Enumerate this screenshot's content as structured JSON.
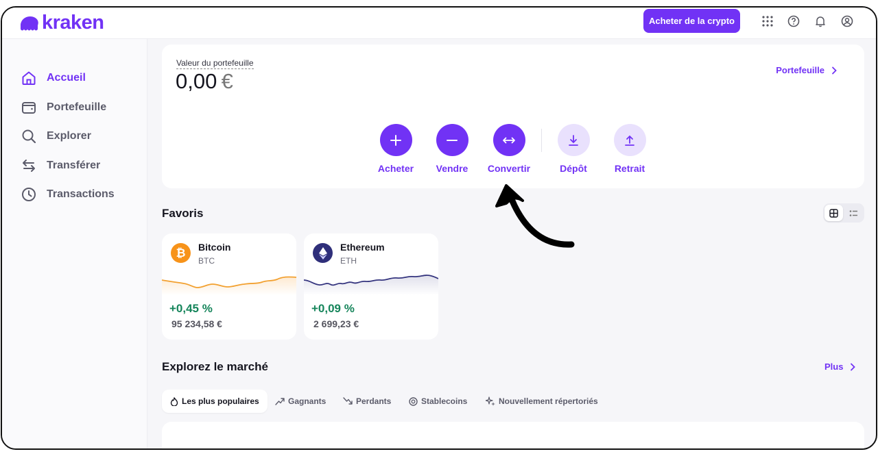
{
  "header": {
    "brand": "kraken",
    "buy_crypto_label": "Acheter de la crypto",
    "icons": [
      "apps-grid-icon",
      "help-icon",
      "bell-icon",
      "account-icon"
    ]
  },
  "sidebar": {
    "items": [
      {
        "label": "Accueil",
        "icon": "home-icon",
        "active": true
      },
      {
        "label": "Portefeuille",
        "icon": "wallet-icon",
        "active": false
      },
      {
        "label": "Explorer",
        "icon": "search-icon",
        "active": false
      },
      {
        "label": "Transférer",
        "icon": "transfer-icon",
        "active": false
      },
      {
        "label": "Transactions",
        "icon": "clock-icon",
        "active": false
      }
    ]
  },
  "portfolio": {
    "label": "Valeur du portefeuille",
    "value": "0,00",
    "currency": "€",
    "link_label": "Portefeuille"
  },
  "actions": [
    {
      "label": "Acheter",
      "icon": "plus-icon"
    },
    {
      "label": "Vendre",
      "icon": "minus-icon"
    },
    {
      "label": "Convertir",
      "icon": "convert-arrows-icon"
    },
    {
      "label": "Dépôt",
      "icon": "download-icon"
    },
    {
      "label": "Retrait",
      "icon": "upload-icon"
    }
  ],
  "favorites": {
    "title": "Favoris",
    "items": [
      {
        "name": "Bitcoin",
        "symbol": "BTC",
        "change": "+0,45 %",
        "price": "95 234,58 €",
        "color": "#f7931a"
      },
      {
        "name": "Ethereum",
        "symbol": "ETH",
        "change": "+0,09 %",
        "price": "2 699,23 €",
        "color": "#2f2f7a"
      }
    ]
  },
  "market": {
    "title": "Explorez le marché",
    "more_label": "Plus",
    "tabs": [
      {
        "label": "Les plus populaires",
        "icon": "flame-icon",
        "selected": true
      },
      {
        "label": "Gagnants",
        "icon": "trend-up-icon",
        "selected": false
      },
      {
        "label": "Perdants",
        "icon": "trend-down-icon",
        "selected": false
      },
      {
        "label": "Stablecoins",
        "icon": "coin-icon",
        "selected": false
      },
      {
        "label": "Nouvellement répertoriés",
        "icon": "sparkle-icon",
        "selected": false
      }
    ]
  },
  "colors": {
    "accent": "#7132f5",
    "positive": "#16855b",
    "background": "#f6f6f9"
  }
}
